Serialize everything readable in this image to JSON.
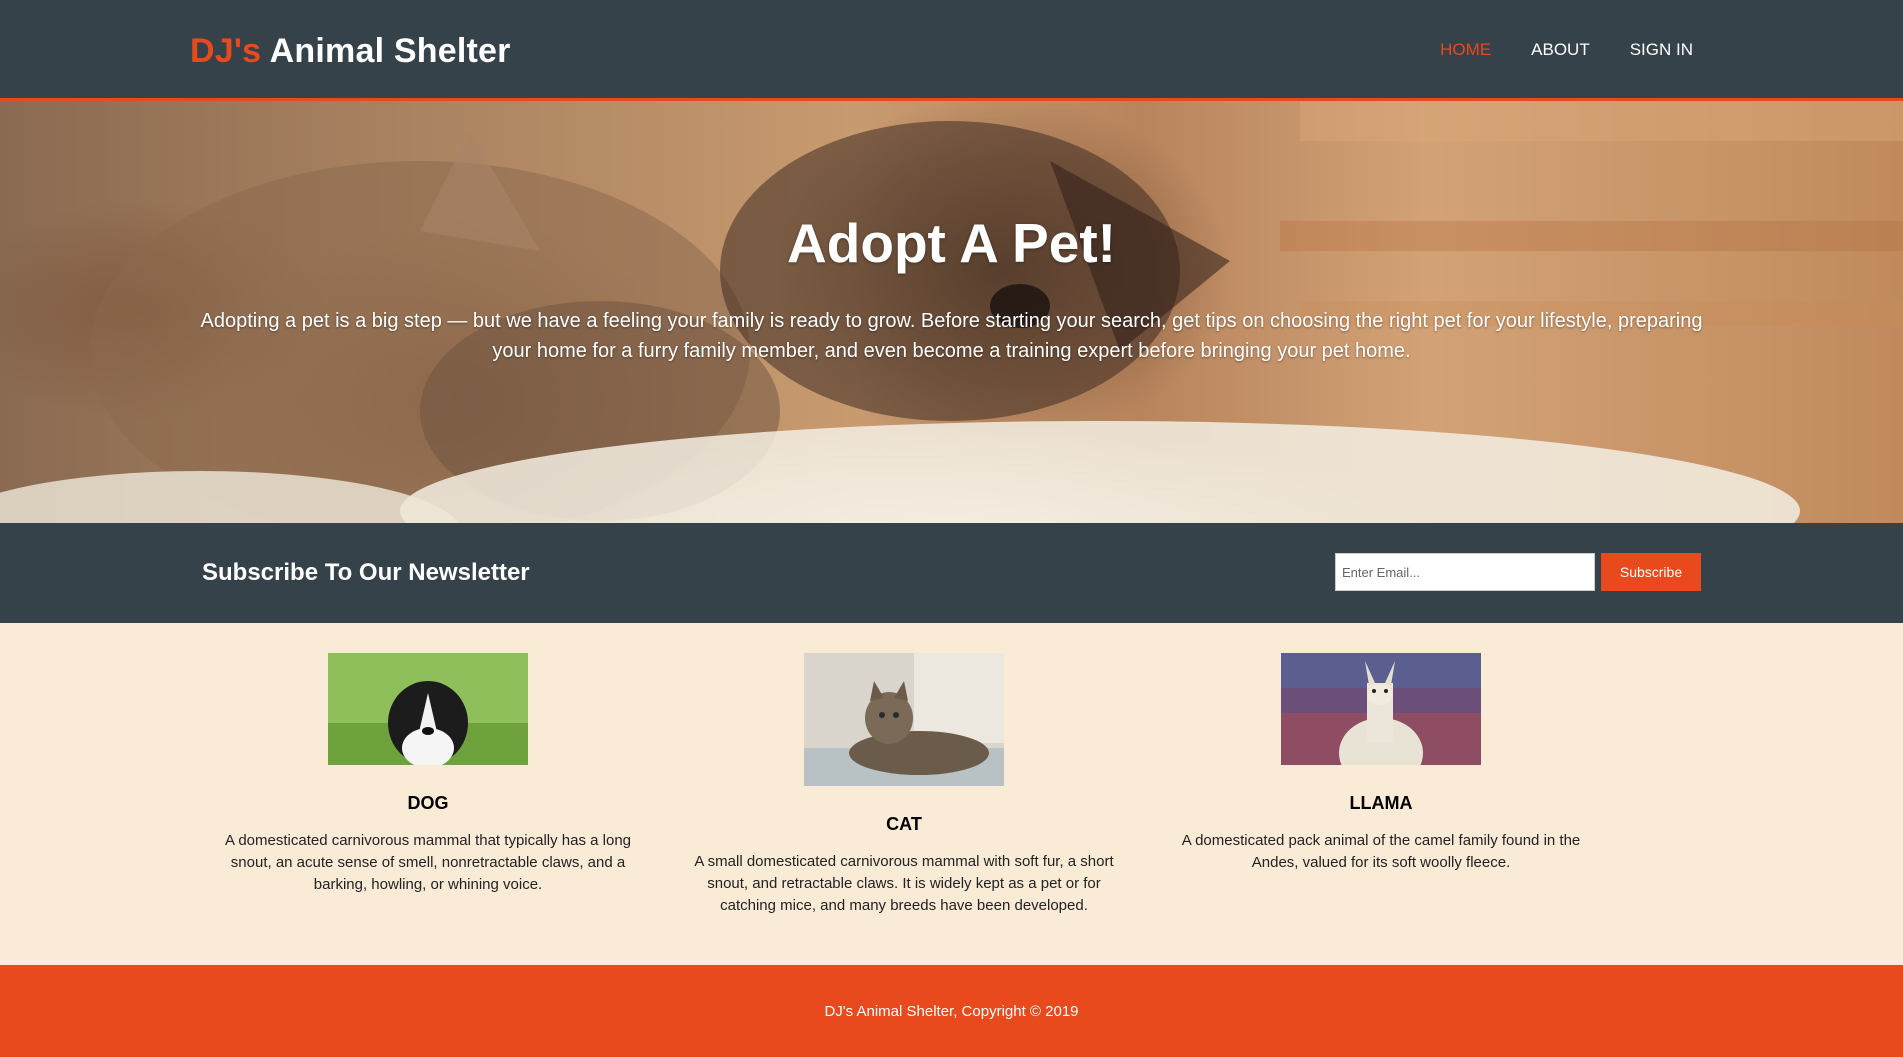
{
  "header": {
    "brand_highlight": "DJ's",
    "brand_rest": "Animal Shelter",
    "nav": [
      "HOME",
      "ABOUT",
      "SIGN IN"
    ]
  },
  "hero": {
    "title": "Adopt A Pet!",
    "text": "Adopting a pet is a big step — but we have a feeling your family is ready to grow. Before starting your search, get tips on choosing the right pet for your lifestyle, preparing your home for a furry family member, and even become a training expert before bringing your pet home."
  },
  "newsletter": {
    "title": "Subscribe To Our Newsletter",
    "email_placeholder": "Enter Email...",
    "button_label": "Subscribe"
  },
  "boxes": [
    {
      "title": "DOG",
      "text": "A domesticated carnivorous mammal that typically has a long snout, an acute sense of smell, nonretractable claws, and a barking, howling, or whining voice."
    },
    {
      "title": "CAT",
      "text": "A small domesticated carnivorous mammal with soft fur, a short snout, and retractable claws. It is widely kept as a pet or for catching mice, and many breeds have been developed."
    },
    {
      "title": "LLAMA",
      "text": "A domesticated pack animal of the camel family found in the Andes, valued for its soft woolly fleece."
    }
  ],
  "footer": {
    "text": "DJ's Animal Shelter, Copyright © 2019"
  },
  "colors": {
    "dark": "#35424a",
    "accent": "#e8491d",
    "cream": "#faebd7"
  }
}
